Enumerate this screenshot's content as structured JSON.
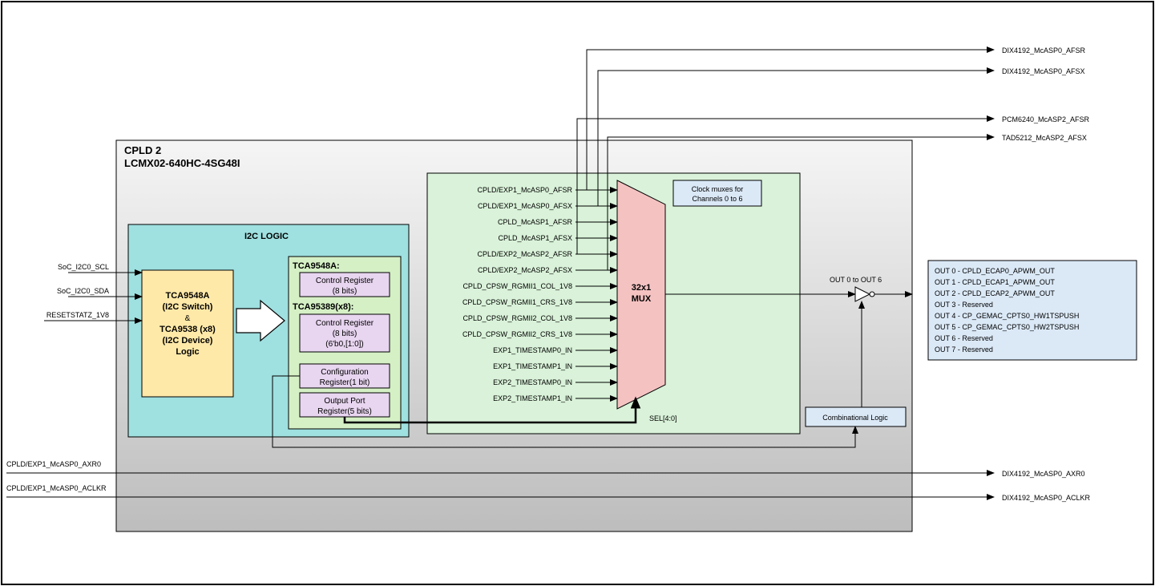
{
  "outer": {
    "frame": ""
  },
  "cpld": {
    "title1": "CPLD 2",
    "title2": "LCMX02-640HC-4SG48I"
  },
  "i2c": {
    "title": "I2C LOGIC",
    "device": {
      "l1": "TCA9548A",
      "l2": "(I2C Switch)",
      "l3": "&",
      "l4": "TCA9538 (x8)",
      "l5": "(I2C Device)",
      "l6": "Logic"
    },
    "regs9548_title": "TCA9548A:",
    "regs9548_ctrl1": "Control Register",
    "regs9548_ctrl2": "(8 bits)",
    "regs9538_title": "TCA95389(x8):",
    "regs9538_ctrl1": "Control Register",
    "regs9538_ctrl2": "(8 bits)",
    "regs9538_ctrl3": "(6'b0,[1:0])",
    "regs9538_cfg1": "Configuration",
    "regs9538_cfg2": "Register(1 bit)",
    "regs9538_out1": "Output Port",
    "regs9538_out2": "Register(5 bits)"
  },
  "left_inputs": {
    "i0": "SoC_I2C0_SCL",
    "i1": "SoC_I2C0_SDA",
    "i2": "RESETSTATZ_1V8",
    "i3": "CPLD/EXP1_McASP0_AXR0",
    "i4": "CPLD/EXP1_McASP0_ACLKR"
  },
  "mux": {
    "title1": "32x1",
    "title2": "MUX",
    "note1": "Clock muxes for",
    "note2": "Channels 0 to 6",
    "sel": "SEL[4:0]",
    "inputs": [
      "CPLD/EXP1_McASP0_AFSR",
      "CPLD/EXP1_McASP0_AFSX",
      "CPLD_McASP1_AFSR",
      "CPLD_McASP1_AFSX",
      "CPLD/EXP2_McASP2_AFSR",
      "CPLD/EXP2_McASP2_AFSX",
      "CPLD_CPSW_RGMII1_COL_1V8",
      "CPLD_CPSW_RGMII1_CRS_1V8",
      "CPLD_CPSW_RGMII2_COL_1V8",
      "CPLD_CPSW_RGMII2_CRS_1V8",
      "EXP1_TIMESTAMP0_IN",
      "EXP1_TIMESTAMP1_IN",
      "EXP2_TIMESTAMP0_IN",
      "EXP2_TIMESTAMP1_IN"
    ]
  },
  "right_outputs": {
    "o0": "DIX4192_McASP0_AFSR",
    "o1": "DIX4192_McASP0_AFSX",
    "o2": "PCM6240_McASP2_AFSR",
    "o3": "TAD5212_McASP2_AFSX",
    "o4": "DIX4192_McASP0_AXR0",
    "o5": "DIX4192_McASP0_ACLKR",
    "muxout": "OUT 0 to OUT 6"
  },
  "comb": {
    "label": "Combinational Logic"
  },
  "out_table": {
    "rows": [
      "OUT 0 -   CPLD_ECAP0_APWM_OUT",
      "OUT 1 -   CPLD_ECAP1_APWM_OUT",
      "OUT 2 -   CPLD_ECAP2_APWM_OUT",
      "OUT 3 -   Reserved",
      "OUT 4 -   CP_GEMAC_CPTS0_HW1TSPUSH",
      "OUT 5 -   CP_GEMAC_CPTS0_HW2TSPUSH",
      "OUT 6 -   Reserved",
      "OUT 7 -   Reserved"
    ]
  }
}
